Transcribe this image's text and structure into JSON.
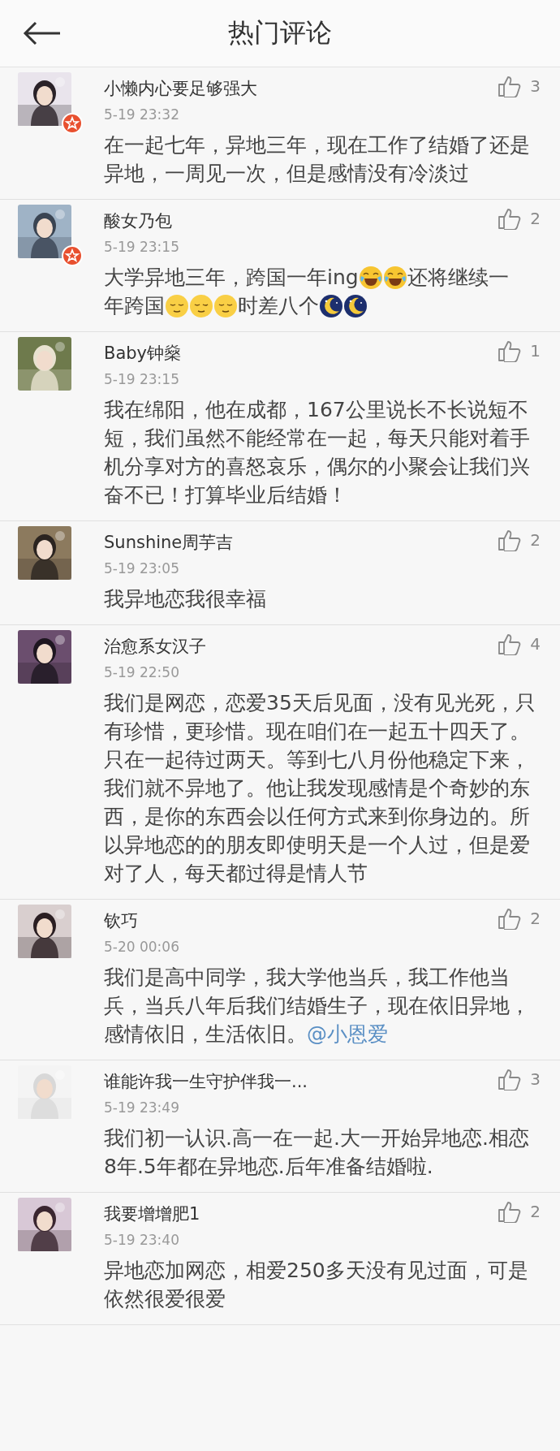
{
  "header": {
    "title": "热门评论"
  },
  "comments": [
    {
      "name": "小懒内心要足够强大",
      "verified": true,
      "time": "5-19 23:32",
      "likes": "3",
      "avatar": {
        "kind": "picture"
      },
      "body": [
        {
          "kind": "text",
          "text": "在一起七年，异地三年，现在工作了结婚了还是异地，一周见一次，但是感情没有冷淡过"
        }
      ]
    },
    {
      "name": "酸女乃包",
      "verified": true,
      "time": "5-19 23:15",
      "likes": "2",
      "avatar": {
        "kind": "picture"
      },
      "body": [
        {
          "kind": "text",
          "text": "大学异地三年，跨国一年ing"
        },
        {
          "kind": "laugh"
        },
        {
          "kind": "laugh"
        },
        {
          "kind": "text",
          "text": "还将继续一"
        },
        {
          "kind": "text",
          "text": "年跨国"
        },
        {
          "kind": "relieved"
        },
        {
          "kind": "relieved"
        },
        {
          "kind": "relieved"
        },
        {
          "kind": "text",
          "text": "时差八个"
        },
        {
          "kind": "moon"
        },
        {
          "kind": "moon"
        }
      ]
    },
    {
      "name": "Baby钟燊",
      "verified": false,
      "time": "5-19 23:15",
      "likes": "1",
      "avatar": {
        "kind": "picture"
      },
      "body": [
        {
          "kind": "text",
          "text": "我在绵阳，他在成都，167公里说长不长说短不短，我们虽然不能经常在一起，每天只能对着手机分享对方的喜怒哀乐，偶尔的小聚会让我们兴奋不已！打算毕业后结婚！"
        }
      ]
    },
    {
      "name": "Sunshine周芋吉",
      "verified": false,
      "time": "5-19 23:05",
      "likes": "2",
      "avatar": {
        "kind": "picture"
      },
      "body": [
        {
          "kind": "text",
          "text": "我异地恋我很幸福"
        }
      ]
    },
    {
      "name": "治愈系女汉子",
      "verified": false,
      "time": "5-19 22:50",
      "likes": "4",
      "avatar": {
        "kind": "picture"
      },
      "body": [
        {
          "kind": "text",
          "text": "我们是网恋，恋爱35天后见面，没有见光死，只有珍惜，更珍惜。现在咱们在一起五十四天了。只在一起待过两天。等到七八月份他稳定下来，我们就不异地了。他让我发现感情是个奇妙的东西，是你的东西会以任何方式来到你身边的。所以异地恋的的朋友即使明天是一个人过，但是爱对了人，每天都过得是情人节"
        }
      ]
    },
    {
      "name": "钦巧",
      "verified": false,
      "time": "5-20 00:06",
      "likes": "2",
      "avatar": {
        "kind": "picture"
      },
      "body": [
        {
          "kind": "text",
          "text": "我们是高中同学，我大学他当兵，我工作他当兵，当兵八年后我们结婚生子，现在依旧异地，感情依旧，生活依旧。"
        },
        {
          "kind": "mention",
          "text": "@小恩爱"
        }
      ]
    },
    {
      "name": "谁能许我一生守护伴我一...",
      "verified": false,
      "time": "5-19 23:49",
      "likes": "3",
      "avatar": {
        "kind": "picture"
      },
      "body": [
        {
          "kind": "text",
          "text": "我们初一认识.高一在一起.大一开始异地恋.相恋8年.5年都在异地恋.后年准备结婚啦."
        }
      ]
    },
    {
      "name": "我要增增肥1",
      "verified": false,
      "time": "5-19 23:40",
      "likes": "2",
      "avatar": {
        "kind": "picture"
      },
      "body": [
        {
          "kind": "text",
          "text": "异地恋加网恋，相爱250多天没有见过面，可是依然很爱很爱"
        }
      ]
    }
  ]
}
